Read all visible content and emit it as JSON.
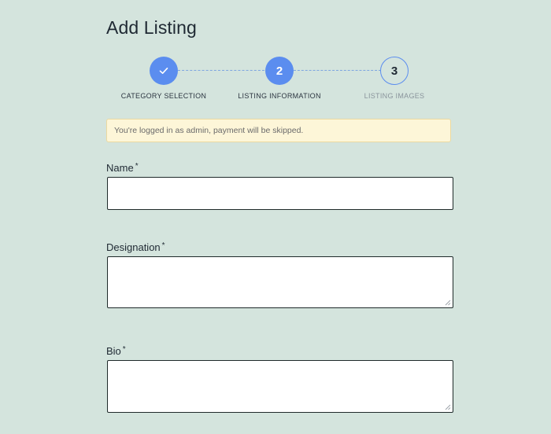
{
  "page": {
    "title": "Add Listing"
  },
  "stepper": {
    "steps": [
      {
        "number": "",
        "label": "CATEGORY SELECTION",
        "state": "completed",
        "icon": "check-icon"
      },
      {
        "number": "2",
        "label": "LISTING INFORMATION",
        "state": "active"
      },
      {
        "number": "3",
        "label": "LISTING IMAGES",
        "state": "pending"
      }
    ],
    "accent_color": "#5b8def"
  },
  "notice": {
    "text": "You're logged in as admin, payment will be skipped.",
    "background": "#fdf6d8"
  },
  "form": {
    "required_marker": "*",
    "fields": [
      {
        "label": "Name",
        "type": "text",
        "value": "",
        "placeholder": ""
      },
      {
        "label": "Designation",
        "type": "textarea",
        "value": "",
        "placeholder": ""
      },
      {
        "label": "Bio",
        "type": "textarea",
        "value": "",
        "placeholder": ""
      }
    ]
  },
  "colors": {
    "background": "#d4e4dd",
    "input_border": "#1f2a2a"
  }
}
